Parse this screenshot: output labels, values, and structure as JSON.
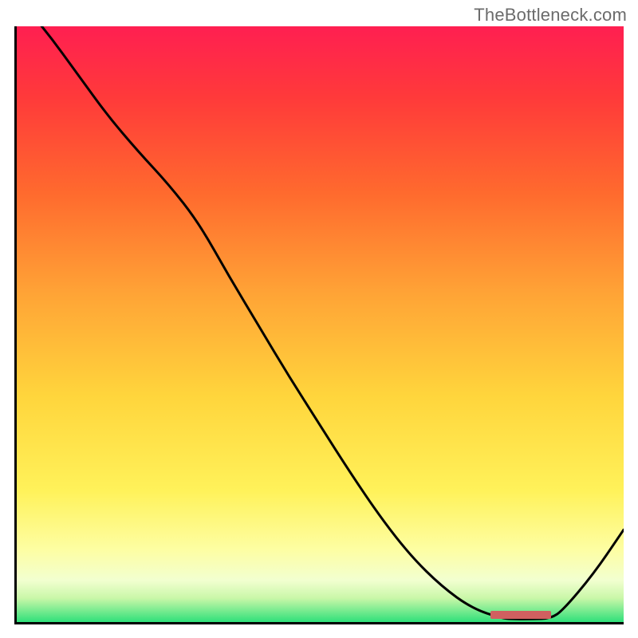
{
  "watermark": "TheBottleneck.com",
  "chart_data": {
    "type": "line",
    "title": "",
    "xlabel": "",
    "ylabel": "",
    "xlim": [
      0,
      100
    ],
    "ylim": [
      0,
      100
    ],
    "x": [
      0,
      5,
      10,
      15,
      20,
      25,
      30,
      35,
      40,
      45,
      50,
      55,
      60,
      65,
      70,
      75,
      80,
      82,
      85,
      88,
      90,
      95,
      100
    ],
    "values": [
      105,
      99,
      92,
      85,
      79,
      73.5,
      67,
      58,
      49.5,
      41,
      33,
      25,
      17.5,
      11,
      6,
      2.3,
      0.6,
      0.5,
      0.5,
      0.6,
      2,
      8,
      15.5
    ],
    "optimal_range": [
      78,
      88
    ],
    "gradient_stops": [
      {
        "pct": 0,
        "color": "#ff1f51"
      },
      {
        "pct": 12,
        "color": "#ff3a3a"
      },
      {
        "pct": 28,
        "color": "#ff6a2e"
      },
      {
        "pct": 45,
        "color": "#ffa436"
      },
      {
        "pct": 62,
        "color": "#ffd53c"
      },
      {
        "pct": 78,
        "color": "#fff25a"
      },
      {
        "pct": 88,
        "color": "#fdfea4"
      },
      {
        "pct": 93,
        "color": "#f2ffd0"
      },
      {
        "pct": 96,
        "color": "#c9f7a8"
      },
      {
        "pct": 100,
        "color": "#2fe07a"
      }
    ]
  }
}
